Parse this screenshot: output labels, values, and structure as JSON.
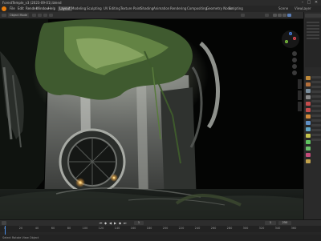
{
  "window": {
    "title": "ForestTemple_v3 (2023-09-01).blend",
    "controls": [
      "–",
      "□",
      "✕"
    ]
  },
  "menu": {
    "items": [
      "File",
      "Edit",
      "Render",
      "Window",
      "Help"
    ],
    "workspaces": [
      "Layout",
      "Modeling",
      "Sculpting",
      "UV Editing",
      "Texture Paint",
      "Shading",
      "Animation",
      "Rendering",
      "Compositing",
      "Geometry Nodes",
      "Scripting"
    ],
    "active_workspace": "Layout",
    "scene_label": "Scene",
    "view_layer_label": "ViewLayer"
  },
  "viewport": {
    "mode_label": "Object Mode",
    "shading": "rendered"
  },
  "gizmo": {
    "axes": [
      "X",
      "Y",
      "Z"
    ],
    "colors": {
      "x": "#e04a55",
      "y": "#7bc03e",
      "z": "#4a7fe0"
    }
  },
  "timeline": {
    "frame_ticks": [
      "0",
      "20",
      "40",
      "60",
      "80",
      "100",
      "120",
      "140",
      "160",
      "180",
      "200",
      "220",
      "240",
      "260",
      "280",
      "300",
      "320",
      "340",
      "360"
    ],
    "current_frame": "1",
    "start_frame": "1",
    "end_frame": "250",
    "playback_icons": [
      "skip-start-icon",
      "prev-key-icon",
      "play-reverse-icon",
      "play-icon",
      "next-key-icon",
      "skip-end-icon"
    ]
  },
  "status": {
    "text": "Select   Rotate View   Object"
  }
}
